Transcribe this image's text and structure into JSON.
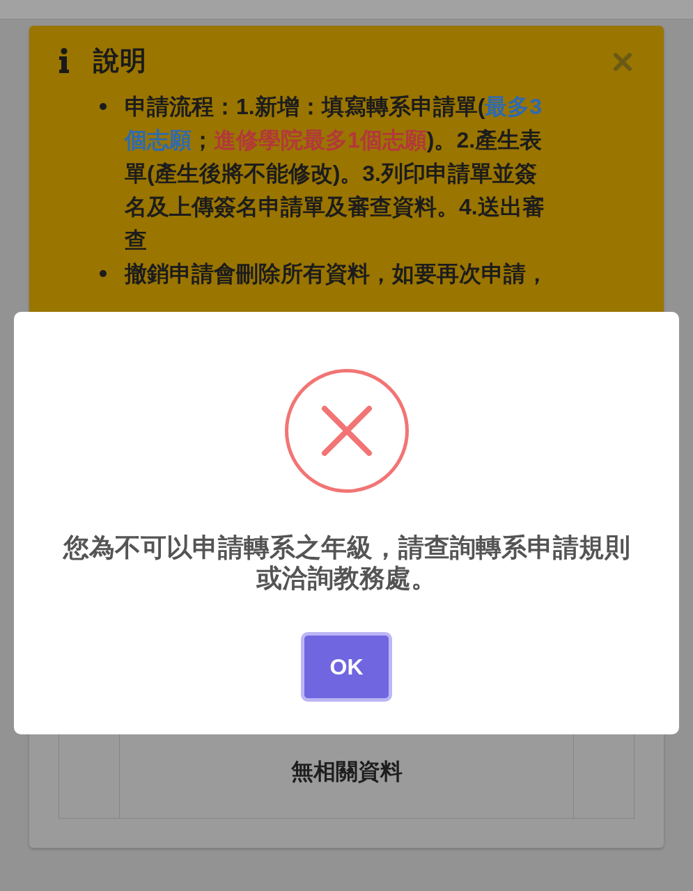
{
  "alert": {
    "title": "說明",
    "dismissible": true,
    "bullets": [
      {
        "segments": [
          {
            "text": "申請流程：1.新增：填寫轉系申請單(",
            "color": "#1c1c1c"
          },
          {
            "text": "最多3個志願",
            "color": "#2d6ab2"
          },
          {
            "text": "；",
            "color": "#1c1c1c"
          },
          {
            "text": "進修學院最多1個志願",
            "color": "#b3383a"
          },
          {
            "text": ")。2.產生表單(產生後將不能修改)。3.列印申請單並簽名及上傳簽名申請單及審查資料。4.送出審查",
            "color": "#1c1c1c"
          }
        ]
      },
      {
        "segments": [
          {
            "text": "撤銷申請會刪除所有資料，如要再次申請，",
            "color": "#1c1c1c"
          }
        ]
      }
    ]
  },
  "table": {
    "empty_message": "無相關資料"
  },
  "modal": {
    "kind": "error",
    "message": "您為不可以申請轉系之年級，請查詢轉系申請規則或洽詢教務處。",
    "button": {
      "label": "OK",
      "focused": true
    }
  }
}
